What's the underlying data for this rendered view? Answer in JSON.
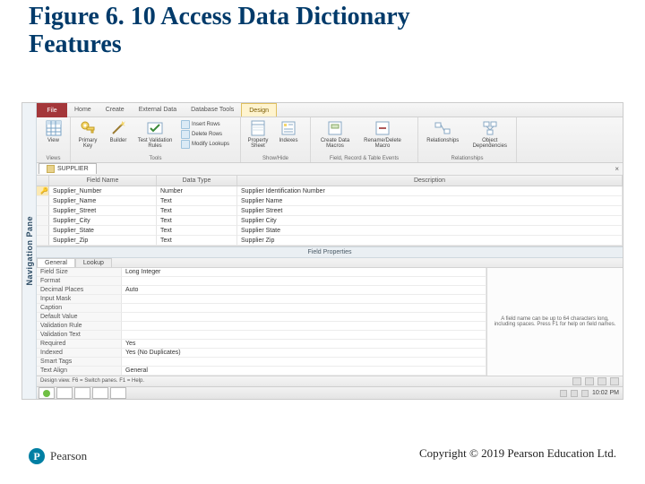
{
  "slide": {
    "title_line1": "Figure 6. 10 Access Data Dictionary",
    "title_line2": "Features",
    "copyright": "Copyright © 2019 Pearson Education Ltd.",
    "pearson_brand": "Pearson",
    "pearson_initial": "P"
  },
  "ribbon": {
    "file": "File",
    "tabs": [
      "Home",
      "Create",
      "External Data",
      "Database Tools"
    ],
    "context_tab": "Design",
    "groups": {
      "views": {
        "label": "Views",
        "view_btn": "View"
      },
      "tools": {
        "label": "Tools",
        "primary_key": "Primary Key",
        "builder": "Builder",
        "test_validation": "Test Validation Rules",
        "insert_rows": "Insert Rows",
        "delete_rows": "Delete Rows",
        "modify_lookups": "Modify Lookups"
      },
      "showhide": {
        "label": "Show/Hide",
        "property_sheet": "Property Sheet",
        "indexes": "Indexes"
      },
      "events": {
        "label": "Field, Record & Table Events",
        "create_macros": "Create Data Macros",
        "rename_delete": "Rename/Delete Macro"
      },
      "relationships": {
        "label": "Relationships",
        "relationships": "Relationships",
        "obj_dep": "Object Dependencies"
      }
    }
  },
  "navpane": {
    "label": "Navigation Pane"
  },
  "object_tab": {
    "name": "SUPPLIER"
  },
  "grid": {
    "headers": {
      "field_name": "Field Name",
      "data_type": "Data Type",
      "description": "Description"
    },
    "rows": [
      {
        "key": true,
        "name": "Supplier_Number",
        "type": "Number",
        "desc": "Supplier Identification Number"
      },
      {
        "key": false,
        "name": "Supplier_Name",
        "type": "Text",
        "desc": "Supplier Name"
      },
      {
        "key": false,
        "name": "Supplier_Street",
        "type": "Text",
        "desc": "Supplier Street"
      },
      {
        "key": false,
        "name": "Supplier_City",
        "type": "Text",
        "desc": "Supplier City"
      },
      {
        "key": false,
        "name": "Supplier_State",
        "type": "Text",
        "desc": "Supplier State"
      },
      {
        "key": false,
        "name": "Supplier_Zip",
        "type": "Text",
        "desc": "Supplier Zip"
      }
    ]
  },
  "props": {
    "header": "Field Properties",
    "tabs": {
      "general": "General",
      "lookup": "Lookup"
    },
    "rows": [
      {
        "label": "Field Size",
        "value": "Long Integer"
      },
      {
        "label": "Format",
        "value": ""
      },
      {
        "label": "Decimal Places",
        "value": "Auto"
      },
      {
        "label": "Input Mask",
        "value": ""
      },
      {
        "label": "Caption",
        "value": ""
      },
      {
        "label": "Default Value",
        "value": ""
      },
      {
        "label": "Validation Rule",
        "value": ""
      },
      {
        "label": "Validation Text",
        "value": ""
      },
      {
        "label": "Required",
        "value": "Yes"
      },
      {
        "label": "Indexed",
        "value": "Yes (No Duplicates)"
      },
      {
        "label": "Smart Tags",
        "value": ""
      },
      {
        "label": "Text Align",
        "value": "General"
      }
    ],
    "help": "A field name can be up to 64 characters long, including spaces. Press F1 for help on field names."
  },
  "statusbar": {
    "text": "Design view.  F6 = Switch panes.  F1 = Help."
  },
  "taskbar": {
    "time": "10:02 PM"
  }
}
